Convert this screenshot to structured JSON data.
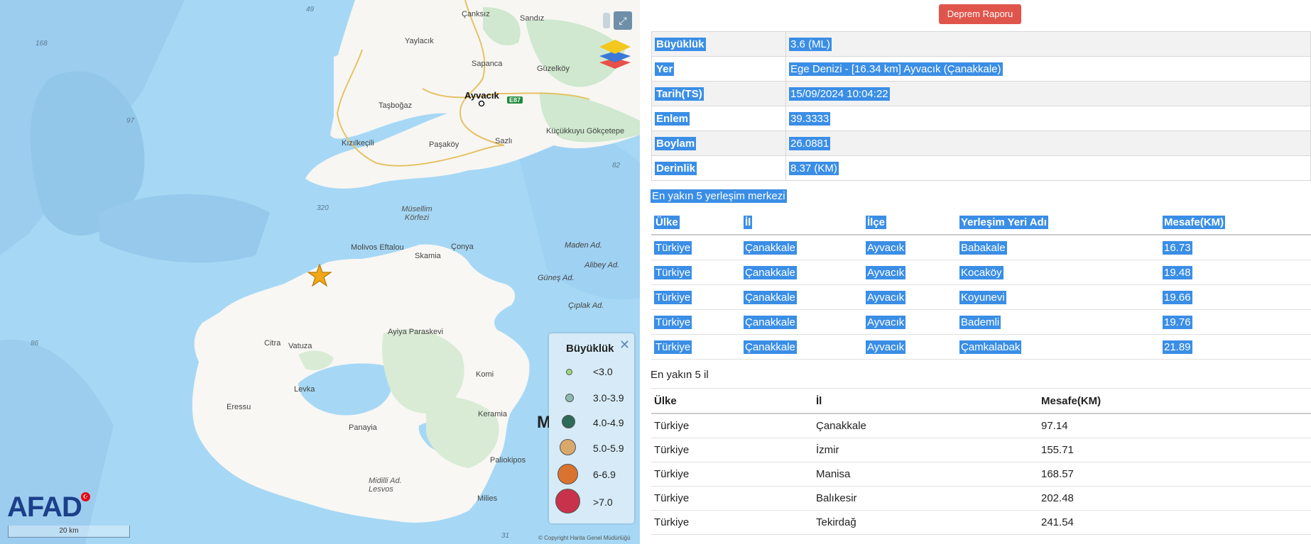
{
  "map": {
    "labels": {
      "canksiz": "Çanksız",
      "sandiz": "Sandız",
      "yaylacik": "Yaylacık",
      "sapanca": "Sapanca",
      "guzelkoy": "Güzelköy",
      "ayvacik": "Ayvacık",
      "tasbogaz": "Taşboğaz",
      "kucukkuyu": "Küçükkuyu Gökçetepe",
      "kizilkecili": "Kızılkeçili",
      "pasakoy": "Paşaköy",
      "sazli": "Sazlı",
      "musellim": "Müsellim Körfezi",
      "molivos": "Molivos Eftalou",
      "skamia": "Skamia",
      "conya": "Çonya",
      "madenad": "Maden Ad.",
      "alibeyad": "Alibey Ad.",
      "gunesad": "Güneş Ad.",
      "ciplakad": "Çıplak Ad.",
      "ayiya": "Ayiya Paraskevi",
      "citra": "Citra",
      "vatuza": "Vatuza",
      "komi": "Komi",
      "levka": "Levka",
      "eressu": "Eressu",
      "keramia": "Keramia",
      "panayia": "Panayia",
      "m_partial": "M",
      "paliokipos": "Paliokipos",
      "midilli": "Midilli Ad. Lesvos",
      "milies": "Milies",
      "e87": "E87"
    },
    "depths": [
      "49",
      "168",
      "97",
      "82",
      "320",
      "86",
      "31"
    ],
    "legend": {
      "title": "Büyüklük",
      "items": [
        {
          "label": "<3.0",
          "color": "#9fd680"
        },
        {
          "label": "3.0-3.9",
          "color": "#8fb9b0"
        },
        {
          "label": "4.0-4.9",
          "color": "#2d6a57"
        },
        {
          "label": "5.0-5.9",
          "color": "#d9a96b"
        },
        {
          "label": "6-6.9",
          "color": "#d9732f"
        },
        {
          "label": ">7.0",
          "color": "#c8324a"
        }
      ]
    },
    "logo": "AFAD",
    "scale": "20 km",
    "copyright": "© Copyright Harita Genel Müdürlüğü",
    "icons": [
      "star-icon",
      "fullscreen-icon",
      "layers-icon",
      "close-icon"
    ]
  },
  "report_button": "Deprem Raporu",
  "info": [
    {
      "key": "Büyüklük",
      "value": "3.6 (ML)"
    },
    {
      "key": "Yer",
      "value": "Ege Denizi - [16.34 km] Ayvacık (Çanakkale)"
    },
    {
      "key": "Tarih(TS)",
      "value": "15/09/2024 10:04:22"
    },
    {
      "key": "Enlem",
      "value": "39.3333"
    },
    {
      "key": "Boylam",
      "value": "26.0881"
    },
    {
      "key": "Derinlik",
      "value": "8.37 (KM)"
    }
  ],
  "nearest_settlements": {
    "title": "En yakın 5 yerleşim merkezi",
    "headers": [
      "Ülke",
      "İl",
      "İlçe",
      "Yerleşim Yeri Adı",
      "Mesafe(KM)"
    ],
    "rows": [
      [
        "Türkiye",
        "Çanakkale",
        "Ayvacık",
        "Babakale",
        "16.73"
      ],
      [
        "Türkiye",
        "Çanakkale",
        "Ayvacık",
        "Kocaköy",
        "19.48"
      ],
      [
        "Türkiye",
        "Çanakkale",
        "Ayvacık",
        "Koyunevi",
        "19.66"
      ],
      [
        "Türkiye",
        "Çanakkale",
        "Ayvacık",
        "Bademli",
        "19.76"
      ],
      [
        "Türkiye",
        "Çanakkale",
        "Ayvacık",
        "Çamkalabak",
        "21.89"
      ]
    ]
  },
  "nearest_provinces": {
    "title": "En yakın 5 il",
    "headers": [
      "Ülke",
      "İl",
      "Mesafe(KM)"
    ],
    "rows": [
      [
        "Türkiye",
        "Çanakkale",
        "97.14"
      ],
      [
        "Türkiye",
        "İzmir",
        "155.71"
      ],
      [
        "Türkiye",
        "Manisa",
        "168.57"
      ],
      [
        "Türkiye",
        "Balıkesir",
        "202.48"
      ],
      [
        "Türkiye",
        "Tekirdağ",
        "241.54"
      ]
    ]
  }
}
